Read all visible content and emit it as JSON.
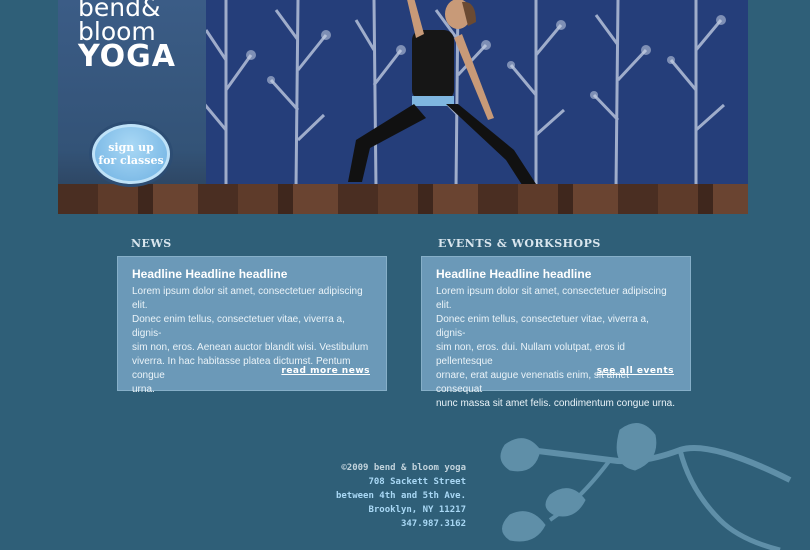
{
  "brand": {
    "logo_line1": "bend&",
    "logo_line2": "bloom",
    "logo_line3": "YOGA",
    "cta_line1": "sign up",
    "cta_line2": "for classes"
  },
  "news": {
    "section_title": "NEWS",
    "headline": "Headline Headline headline",
    "lines": [
      "Lorem ipsum dolor sit amet, consectetuer adipiscing elit.",
      "Donec enim tellus, consectetuer vitae, viverra a, dignis-",
      "sim non, eros. Aenean auctor blandit wisi. Vestibulum",
      "viverra. In hac habitasse platea dictumst. Pentum congue",
      "urna."
    ],
    "link": "read more news"
  },
  "events": {
    "section_title": "EVENTS & WORKSHOPS",
    "headline": "Headline Headline headline",
    "lines": [
      "Lorem ipsum dolor sit amet, consectetuer adipiscing elit.",
      "Donec enim tellus, consectetuer vitae, viverra a, dignis-",
      "sim non, eros. dui. Nullam volutpat, eros id pellentesque",
      "ornare, erat augue venenatis enim, sit amet consequat",
      "nunc massa sit amet felis. condimentum congue urna."
    ],
    "link": "see all events"
  },
  "footer": {
    "copyright": "©2009 bend & bloom yoga",
    "street": "708 Sackett Street",
    "cross": "between 4th and 5th Ave.",
    "city": "Brooklyn, NY 11217",
    "phone": "347.987.3162"
  },
  "colors": {
    "background": "#2f5f78",
    "card": "#6b99b8",
    "cta": "#7fbde8",
    "link_blue": "#a9d8f5"
  }
}
